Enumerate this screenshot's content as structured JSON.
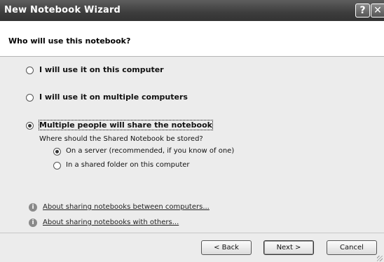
{
  "window": {
    "title": "New Notebook Wizard"
  },
  "titlebar": {
    "help_glyph": "?",
    "close_glyph": "✕"
  },
  "header": {
    "question": "Who will use this notebook?"
  },
  "options": [
    {
      "label": "I will use it on this computer",
      "checked": false
    },
    {
      "label": "I will use it on multiple computers",
      "checked": false
    },
    {
      "label": "Multiple people will share the notebook",
      "checked": true
    }
  ],
  "shared": {
    "prompt": "Where should the Shared Notebook be stored?",
    "choices": [
      {
        "label": "On a server (recommended, if you know of one)",
        "checked": true
      },
      {
        "label": "In a shared folder on this computer",
        "checked": false
      }
    ]
  },
  "links": [
    {
      "text": "About sharing notebooks between computers...",
      "icon": "info-icon"
    },
    {
      "text": "About sharing notebooks with others...",
      "icon": "info-icon"
    }
  ],
  "footer": {
    "back": "< Back",
    "next": "Next >",
    "cancel": "Cancel"
  }
}
